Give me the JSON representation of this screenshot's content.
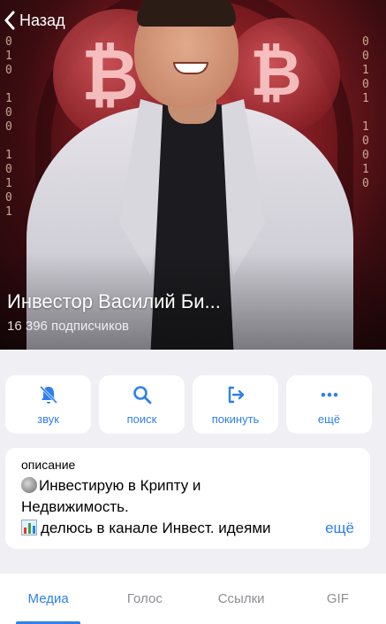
{
  "header": {
    "back_label": "Назад",
    "title": "Инвестор Василий Би...",
    "subscribers": "16 396 подписчиков"
  },
  "actions": [
    {
      "label": "звук",
      "icon": "bell-icon"
    },
    {
      "label": "поиск",
      "icon": "search-icon"
    },
    {
      "label": "покинуть",
      "icon": "leave-icon"
    },
    {
      "label": "ещё",
      "icon": "more-icon"
    }
  ],
  "description": {
    "header": "описание",
    "line1": "Инвестирую в Крипту и",
    "line2": "Недвижимость.",
    "line3": "делюсь в канале Инвест. идеями",
    "more": "ещё"
  },
  "tabs": [
    {
      "label": "Медиа",
      "active": true
    },
    {
      "label": "Голос",
      "active": false
    },
    {
      "label": "Ссылки",
      "active": false
    },
    {
      "label": "GIF",
      "active": false
    }
  ],
  "colors": {
    "accent": "#2f80ed",
    "background": "#efeff4"
  }
}
